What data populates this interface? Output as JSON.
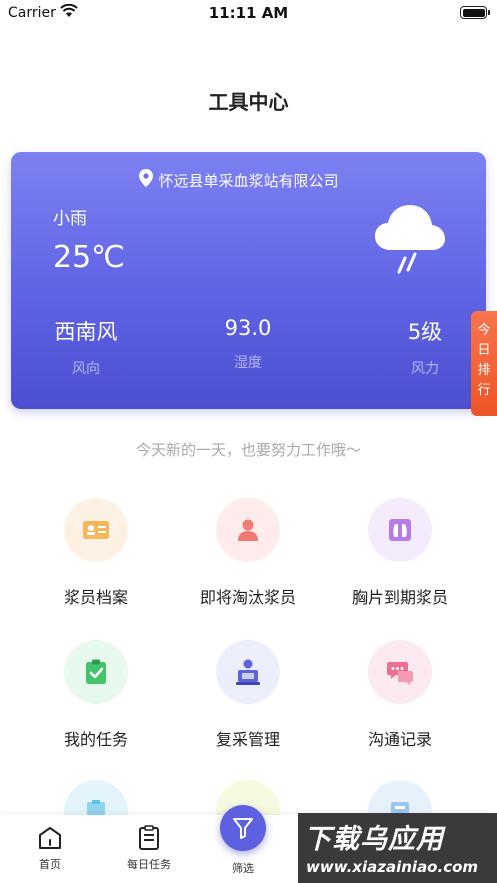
{
  "status_bar": {
    "carrier": "Carrier",
    "time": "11:11 AM"
  },
  "page_title": "工具中心",
  "weather": {
    "location": "怀远县单采血浆站有限公司",
    "condition": "小雨",
    "temperature": "25℃",
    "stats": [
      {
        "value": "西南风",
        "label": "风向"
      },
      {
        "value": "93.0",
        "label": "湿度"
      },
      {
        "value": "5级",
        "label": "风力"
      }
    ]
  },
  "ranking_tab": "今日排行",
  "motto": "今天新的一天，也要努力工作哦～",
  "tools": [
    {
      "label": "浆员档案",
      "icon": "id-card-icon",
      "bg": "#fdf1e3",
      "fg": "#f6b65a"
    },
    {
      "label": "即将淘汰浆员",
      "icon": "person-icon",
      "bg": "#fdeceb",
      "fg": "#f07a73"
    },
    {
      "label": "胸片到期浆员",
      "icon": "chest-xray-icon",
      "bg": "#f4ecfc",
      "fg": "#b77be8"
    },
    {
      "label": "我的任务",
      "icon": "clipboard-check-icon",
      "bg": "#e6f9ec",
      "fg": "#44c46a"
    },
    {
      "label": "复采管理",
      "icon": "computer-user-icon",
      "bg": "#eceefc",
      "fg": "#5a66d8"
    },
    {
      "label": "沟通记录",
      "icon": "chat-bubbles-icon",
      "bg": "#fdeaf0",
      "fg": "#ef6f93"
    },
    {
      "label": "",
      "icon": "clipboard-icon",
      "bg": "#e3f5fb",
      "fg": "#5cc2e6"
    },
    {
      "label": "",
      "icon": "misc-icon",
      "bg": "#f6fadf",
      "fg": "#c9dd5c"
    },
    {
      "label": "",
      "icon": "document-icon",
      "bg": "#e6f1fc",
      "fg": "#6aa9ea"
    }
  ],
  "tab_bar": {
    "home": "首页",
    "daily_tasks": "每日任务",
    "filter": "筛选"
  },
  "watermark": {
    "main": "下载乌应用",
    "url": "www.xiazainiao.com"
  },
  "colors": {
    "accent": "#5d60df",
    "ranking": "#ef5a2c"
  }
}
